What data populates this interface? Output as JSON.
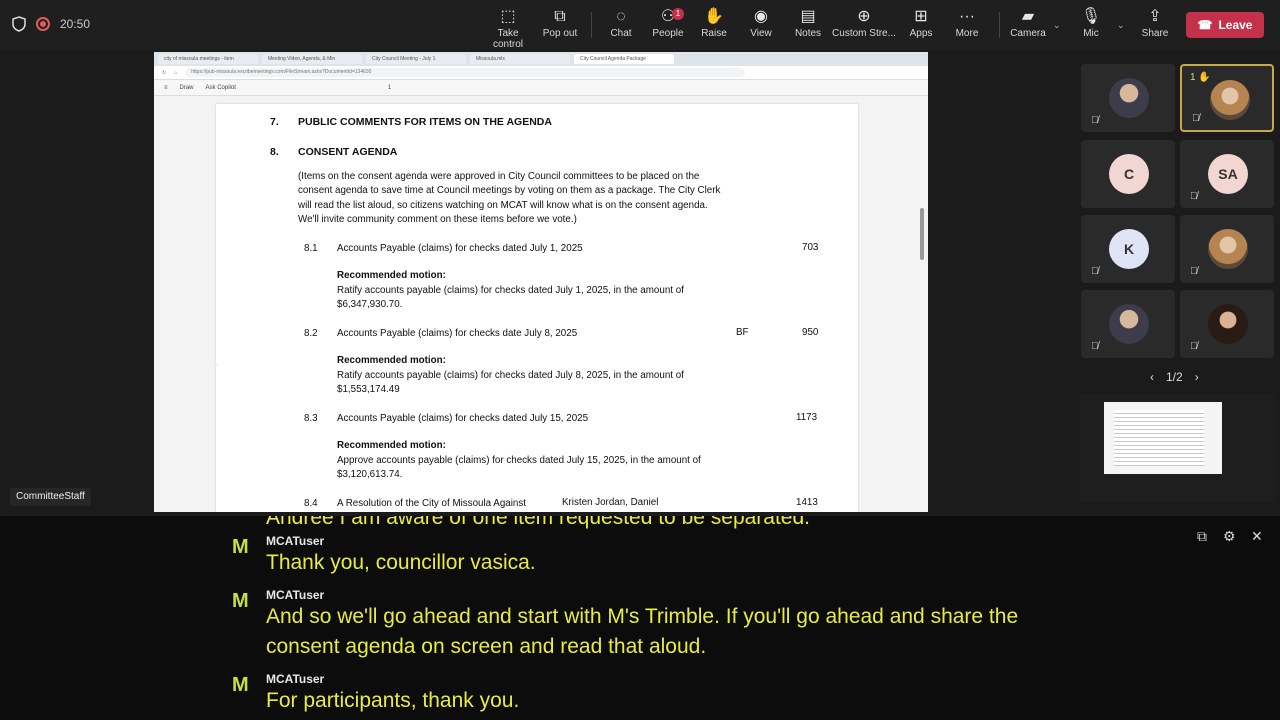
{
  "topbar": {
    "timer": "20:50",
    "buttons": [
      {
        "key": "take-control",
        "label": "Take control",
        "icon": "take-control-icon"
      },
      {
        "key": "pop-out",
        "label": "Pop out",
        "icon": "pop-out-icon"
      },
      {
        "key": "chat",
        "label": "Chat",
        "icon": "chat-icon"
      },
      {
        "key": "people",
        "label": "People",
        "icon": "people-icon",
        "badge": "1"
      },
      {
        "key": "raise",
        "label": "Raise",
        "icon": "raise-hand-icon"
      },
      {
        "key": "view",
        "label": "View",
        "icon": "view-icon"
      },
      {
        "key": "notes",
        "label": "Notes",
        "icon": "notes-icon"
      },
      {
        "key": "custom-streaming",
        "label": "Custom Stre...",
        "icon": "globe-icon"
      },
      {
        "key": "apps",
        "label": "Apps",
        "icon": "apps-icon"
      },
      {
        "key": "more",
        "label": "More",
        "icon": "more-icon"
      },
      {
        "key": "camera",
        "label": "Camera",
        "icon": "camera-icon"
      },
      {
        "key": "mic",
        "label": "Mic",
        "icon": "mic-icon"
      },
      {
        "key": "share",
        "label": "Share",
        "icon": "share-icon"
      }
    ],
    "leave_label": "Leave"
  },
  "browser": {
    "tabs": [
      "city of missoula meetings - item",
      "Meeting Video, Agenda, & Min",
      "City Council Meeting - July 1",
      "Missoula.mlx",
      "City Council Agenda Package"
    ],
    "url": "https://pub-missoula.escribemeetings.com/FileStream.ashx?DocumentId=134630",
    "toolbar": [
      "Draw",
      "Ask Copilot",
      "1"
    ]
  },
  "document": {
    "item7": {
      "num": "7.",
      "title": "PUBLIC COMMENTS FOR ITEMS ON THE AGENDA"
    },
    "item8": {
      "num": "8.",
      "title": "CONSENT AGENDA"
    },
    "intro_lines": [
      "(Items on the consent agenda were approved in City Council committees to be placed on the",
      "consent agenda to save time at Council meetings by voting on them as a package. The City Clerk",
      "will read the list aloud, so citizens watching on MCAT will know what is on the consent agenda.",
      "We'll invite community comment on these items before we vote.)"
    ],
    "motion_label": "Recommended motion:",
    "items": [
      {
        "num": "8.1",
        "title": "Accounts Payable (claims) for checks dated July 1, 2025",
        "sponsor": "",
        "page": "703",
        "motion_line1": "Ratify accounts payable (claims) for checks dated July 1, 2025, in the amount of",
        "motion_line2": "$6,347,930.70."
      },
      {
        "num": "8.2",
        "title": "Accounts Payable (claims) for checks date July 8, 2025",
        "sponsor": "BF",
        "page": "950",
        "motion_line1": "Ratify accounts payable (claims) for checks dated July 8, 2025, in the amount of",
        "motion_line2": "$1,553,174.49"
      },
      {
        "num": "8.3",
        "title": "Accounts Payable (claims) for checks dated July 15, 2025",
        "sponsor": "",
        "page": "1173",
        "motion_line1": "Approve accounts payable (claims) for checks dated July 15, 2025, in the amount of",
        "motion_line2": "$3,120,613.74."
      },
      {
        "num": "8.4",
        "title": "A Resolution of the City of Missoula Against",
        "sponsor": "Kristen Jordan, Daniel",
        "page": "1413",
        "motion_line1": "",
        "motion_line2": ""
      }
    ]
  },
  "participants": [
    {
      "initials": "",
      "kind": "photo",
      "muted": true,
      "raised": false,
      "speaking": false
    },
    {
      "initials": "",
      "kind": "photo2",
      "muted": true,
      "raised": true,
      "hand_count": "1",
      "speaking": true
    },
    {
      "initials": "C",
      "kind": "initials",
      "color": "#f2d6d2",
      "muted": false,
      "raised": false,
      "speaking": false
    },
    {
      "initials": "SA",
      "kind": "initials",
      "color": "#f2d6d2",
      "muted": true,
      "raised": false,
      "speaking": false
    },
    {
      "initials": "K",
      "kind": "initials",
      "color": "#dfe3f5",
      "muted": true,
      "raised": false,
      "speaking": false
    },
    {
      "initials": "",
      "kind": "photo2",
      "muted": true,
      "raised": false,
      "speaking": false
    },
    {
      "initials": "",
      "kind": "photo",
      "muted": true,
      "raised": false,
      "speaking": false
    },
    {
      "initials": "",
      "kind": "photo3",
      "muted": true,
      "raised": false,
      "speaking": false
    }
  ],
  "pager": {
    "label": "1/2"
  },
  "staff_label": "CommitteeStaff",
  "captions": {
    "fragment": "Andree I am aware of one item requested to be separated.",
    "entries": [
      {
        "user": "MCATuser",
        "text": "Thank you, councillor vasica."
      },
      {
        "user": "MCATuser",
        "text": "And so we'll go ahead and start with M's Trimble. If you'll go ahead and share the consent agenda on screen and read that aloud."
      },
      {
        "user": "MCATuser",
        "text": "For participants, thank you."
      }
    ]
  }
}
